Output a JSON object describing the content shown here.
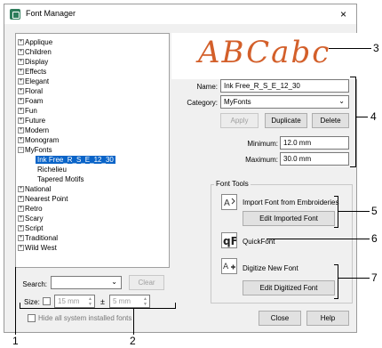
{
  "window": {
    "title": "Font Manager",
    "close": "×"
  },
  "tree": {
    "items": [
      {
        "label": "Applique",
        "exp": "+"
      },
      {
        "label": "Children",
        "exp": "+"
      },
      {
        "label": "Display",
        "exp": "+"
      },
      {
        "label": "Effects",
        "exp": "+"
      },
      {
        "label": "Elegant",
        "exp": "+"
      },
      {
        "label": "Floral",
        "exp": "+"
      },
      {
        "label": "Foam",
        "exp": "+"
      },
      {
        "label": "Fun",
        "exp": "+"
      },
      {
        "label": "Future",
        "exp": "+"
      },
      {
        "label": "Modern",
        "exp": "+"
      },
      {
        "label": "Monogram",
        "exp": "+"
      },
      {
        "label": "MyFonts",
        "exp": "−"
      },
      {
        "label": "National",
        "exp": "+"
      },
      {
        "label": "Nearest Point",
        "exp": "+"
      },
      {
        "label": "Retro",
        "exp": "+"
      },
      {
        "label": "Scary",
        "exp": "+"
      },
      {
        "label": "Script",
        "exp": "+"
      },
      {
        "label": "Traditional",
        "exp": "+"
      },
      {
        "label": "Wild West",
        "exp": "+"
      }
    ],
    "myfonts_children": [
      "Ink Free_R_S_E_12_30",
      "Richelieu",
      "Tapered Motifs"
    ]
  },
  "preview": {
    "text": "ABCabc",
    "color": "#d35f2a"
  },
  "details": {
    "name_label": "Name:",
    "name_value": "Ink Free_R_S_E_12_30",
    "category_label": "Category:",
    "category_value": "MyFonts",
    "apply": "Apply",
    "duplicate": "Duplicate",
    "delete": "Delete",
    "minimum_label": "Minimum:",
    "minimum_value": "12.0 mm",
    "maximum_label": "Maximum:",
    "maximum_value": "30.0 mm"
  },
  "font_tools": {
    "title": "Font Tools",
    "import_label": "Import Font from Embroideries",
    "edit_imported": "Edit Imported Font",
    "quickfont": "QuickFont",
    "digitize_label": "Digitize New Font",
    "edit_digitized": "Edit Digitized Font"
  },
  "search": {
    "label": "Search:",
    "clear": "Clear",
    "size_label": "Size:",
    "size_value": "15 mm",
    "tolerance_symbol": "±",
    "tolerance_value": "5 mm",
    "hide_label": "Hide all system installed fonts"
  },
  "footer": {
    "close": "Close",
    "help": "Help"
  },
  "callouts": {
    "c1": "1",
    "c2": "2",
    "c3": "3",
    "c4": "4",
    "c5": "5",
    "c6": "6",
    "c7": "7"
  }
}
